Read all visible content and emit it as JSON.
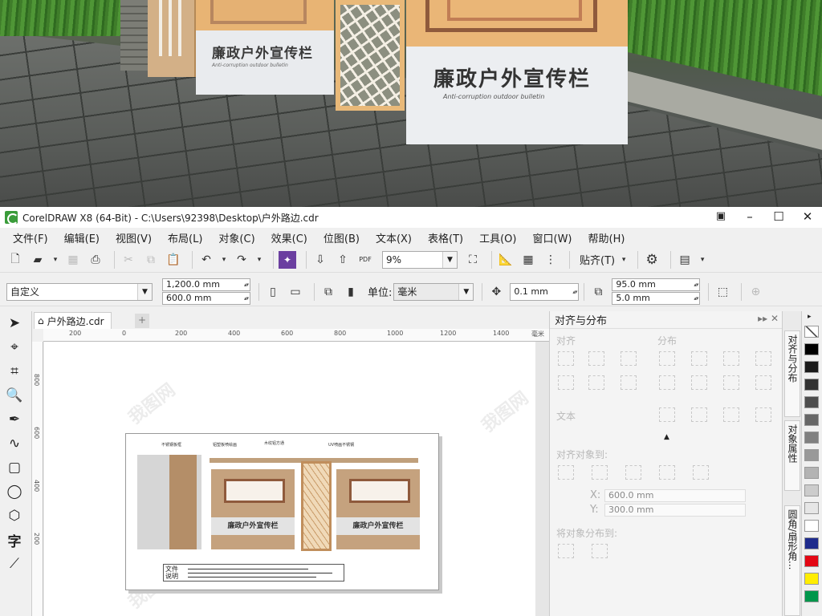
{
  "render_scene": {
    "board_small_title": "廉政户外宣传栏",
    "board_large_title": "廉政户外宣传栏",
    "board_subtitle": "Anti-corruption outdoor bulletin"
  },
  "window": {
    "title": "CorelDRAW X8 (64-Bit) - C:\\Users\\92398\\Desktop\\户外路边.cdr"
  },
  "menu": [
    "文件(F)",
    "编辑(E)",
    "视图(V)",
    "布局(L)",
    "对象(C)",
    "效果(C)",
    "位图(B)",
    "文本(X)",
    "表格(T)",
    "工具(O)",
    "窗口(W)",
    "帮助(H)"
  ],
  "toolbar1": {
    "zoom_value": "9%",
    "snap_label": "贴齐(T)",
    "pdf_label": "PDF"
  },
  "toolbar2": {
    "preset": "自定义",
    "width": "1,200.0 mm",
    "height": "600.0 mm",
    "unit_label": "单位:",
    "unit_value": "毫米",
    "nudge": "0.1 mm",
    "dup_x": "95.0 mm",
    "dup_y": "5.0 mm"
  },
  "document": {
    "tab_name": "户外路边.cdr",
    "hruler_labels": [
      "200",
      "0",
      "200",
      "400",
      "600",
      "800",
      "1000",
      "1200",
      "1400",
      "毫米"
    ],
    "vruler_labels": [
      "800",
      "600",
      "400",
      "200"
    ],
    "annotations": [
      "不锈钢板框",
      "铝塑板喷绘画",
      "木纹铝方通",
      "UV喷画不锈钢"
    ],
    "board_caption_1": "廉政户外宣传栏",
    "board_caption_2": "廉政户外宣传栏",
    "legend_key": "文件\n说明",
    "watermark": "我图网"
  },
  "docker": {
    "title": "对齐与分布",
    "section_align": "对齐",
    "section_distribute": "分布",
    "section_text": "文本",
    "section_align_to": "对齐对象到:",
    "x_label": "X:",
    "x_value": "600.0 mm",
    "y_label": "Y:",
    "y_value": "300.0 mm",
    "section_distribute_to": "将对象分布到:"
  },
  "side_tabs": [
    "对齐与分布",
    "对象属性",
    "圆角/扇形角..."
  ],
  "palette_colors": [
    "#ffffff",
    "#000000",
    "#1a1a1a",
    "#333333",
    "#4d4d4d",
    "#666666",
    "#808080",
    "#999999",
    "#b3b3b3",
    "#cccccc",
    "#e6e6e6",
    "#ffffff",
    "#1e2b8c",
    "#e30613",
    "#ffed00",
    "#00964b"
  ]
}
